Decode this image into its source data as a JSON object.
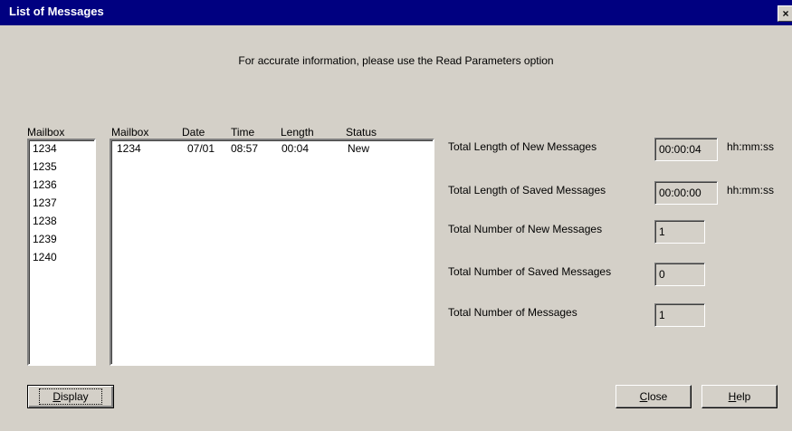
{
  "window": {
    "title": "List of Messages",
    "close_glyph": "×"
  },
  "notice": "For accurate information, please use the Read Parameters option",
  "mailbox_list": {
    "header": "Mailbox",
    "items": [
      "1234",
      "1235",
      "1236",
      "1237",
      "1238",
      "1239",
      "1240"
    ]
  },
  "messages": {
    "columns": [
      "Mailbox",
      "Date",
      "Time",
      "Length",
      "Status"
    ],
    "rows": [
      [
        "1234",
        "07/01",
        "08:57",
        "00:04",
        "New"
      ]
    ]
  },
  "totals": [
    {
      "label": "Total Length of New Messages",
      "value": "00:00:04",
      "unit": "hh:mm:ss"
    },
    {
      "label": "Total Length of Saved Messages",
      "value": "00:00:00",
      "unit": "hh:mm:ss"
    },
    {
      "label": "Total Number of New Messages",
      "value": "1",
      "unit": ""
    },
    {
      "label": "Total Number of Saved Messages",
      "value": "0",
      "unit": ""
    },
    {
      "label": "Total Number of Messages",
      "value": "1",
      "unit": ""
    }
  ],
  "buttons": {
    "display": {
      "first": "D",
      "rest": "isplay"
    },
    "close": {
      "first": "C",
      "rest": "lose"
    },
    "help": {
      "first": "H",
      "rest": "elp"
    }
  }
}
